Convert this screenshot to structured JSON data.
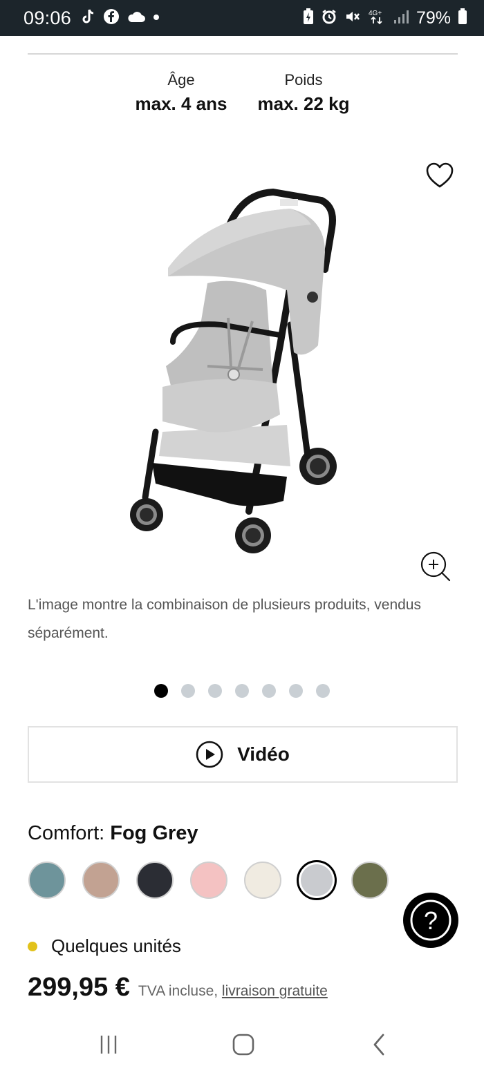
{
  "status_bar": {
    "time": "09:06",
    "left_icons": [
      "tiktok-icon",
      "facebook-icon",
      "cloud-icon",
      "dot-icon"
    ],
    "right_icons": [
      "battery-saver-icon",
      "alarm-icon",
      "mute-icon",
      "network-4g-icon",
      "signal-icon"
    ],
    "network_label": "4G+",
    "battery": "79%"
  },
  "specs": {
    "age_label": "Âge",
    "age_value": "max. 4 ans",
    "weight_label": "Poids",
    "weight_value": "max. 22 kg"
  },
  "product": {
    "image_icon": "stroller-image",
    "disclaimer": "L'image montre la combinaison de plusieurs produits, vendus séparément."
  },
  "carousel": {
    "total": 7,
    "active_index": 0
  },
  "video": {
    "label": "Vidéo"
  },
  "color": {
    "prefix": "Comfort: ",
    "selected_name": "Fog Grey",
    "swatches": [
      "#6e949b",
      "#c2a292",
      "#2b2d34",
      "#f4c2c2",
      "#f0ebe1",
      "#c9cbcf",
      "#6b6f4c"
    ],
    "selected_index": 5
  },
  "stock": {
    "text": "Quelques unités",
    "color": "#e2c21b"
  },
  "price": {
    "amount": "299,95 €",
    "tax_note": "TVA incluse, ",
    "shipping_link": "livraison gratuite"
  },
  "help": {
    "symbol": "?"
  },
  "nav": {
    "recents_icon": "recents-icon",
    "home_icon": "home-icon",
    "back_icon": "back-icon"
  }
}
